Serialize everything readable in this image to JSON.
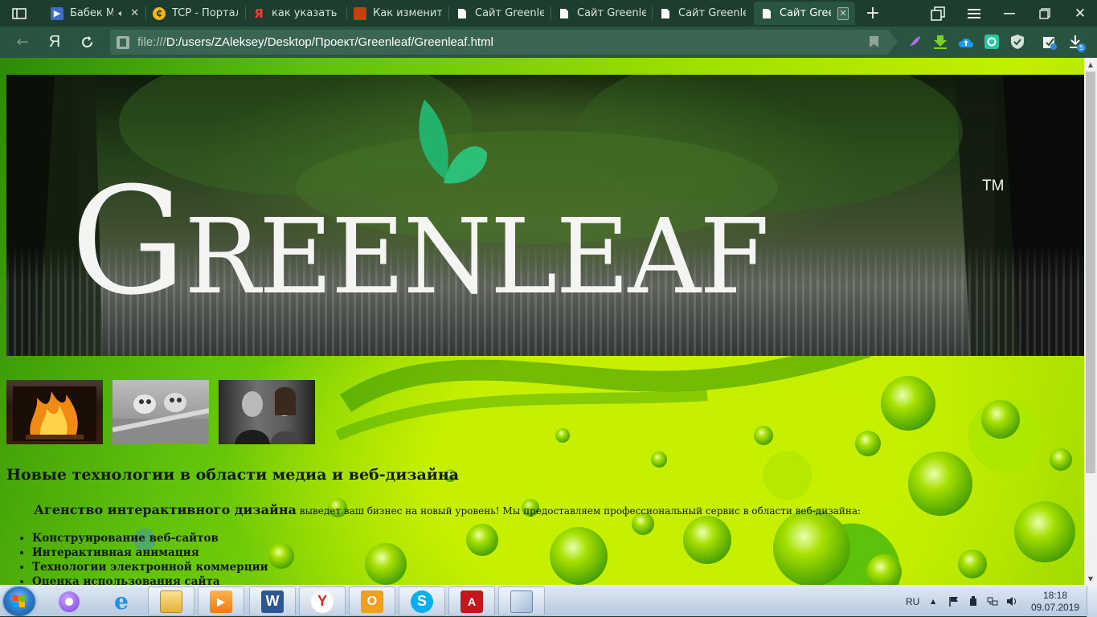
{
  "browser": {
    "tabs": [
      {
        "title": "Бабек М",
        "favicon": "video-favicon",
        "audio": true
      },
      {
        "title": "TCP - Портал",
        "favicon": "portal-favicon"
      },
      {
        "title": "как указать ра",
        "favicon": "yandex-favicon"
      },
      {
        "title": "Как изменить",
        "favicon": "site-favicon"
      },
      {
        "title": "Сайт Greenlea",
        "favicon": "page-favicon"
      },
      {
        "title": "Сайт Greenlea",
        "favicon": "page-favicon"
      },
      {
        "title": "Сайт Greenlea",
        "favicon": "page-favicon"
      },
      {
        "title": "Сайт Green",
        "favicon": "page-favicon",
        "active": true
      }
    ],
    "address": {
      "protocol": "file:///",
      "path": "D:/users/ZAleksey/Desktop/Проект/Greenleaf/Greenleaf.html"
    },
    "yandex_button": "Я",
    "download_count": "5",
    "accent_color": "#285440"
  },
  "page": {
    "logo": {
      "word": "Greenleaf",
      "tm": "TM",
      "leaf_color": "#23b26d"
    },
    "thumbnails": [
      "fireplace-image",
      "toy-cars-image",
      "movie-still-image"
    ],
    "heading": "Новые технологии в области медиа и веб-дизайна",
    "agency": {
      "lead": "Агенство интерактивного дизайна",
      "text": " выведет ваш бизнес на новый уровень! Мы предоставляем профессиональный сервис в области веб-дизайна:"
    },
    "services": [
      "Конструирование веб-сайтов",
      "Интерактивная анимация",
      "Технологии электронной коммерции",
      "Оценка использования сайта"
    ]
  },
  "taskbar": {
    "apps": [
      "alice-icon",
      "internet-explorer-icon",
      "file-explorer-icon",
      "media-player-icon",
      "word-icon",
      "yandex-browser-icon",
      "outlook-icon",
      "skype-icon",
      "acrobat-icon",
      "notes-icon"
    ],
    "language": "RU",
    "time": "18:18",
    "date": "09.07.2019"
  }
}
